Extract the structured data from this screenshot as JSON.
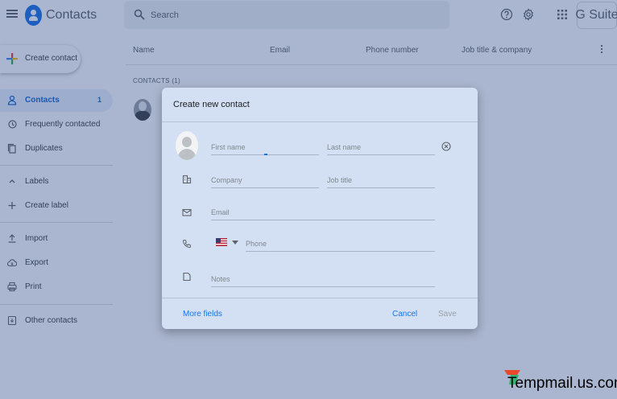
{
  "header": {
    "app_title": "Contacts",
    "search_placeholder": "Search",
    "brand": "G Suite",
    "icons": [
      "menu-icon",
      "contacts-logo-icon",
      "search-icon",
      "help-icon",
      "settings-icon",
      "apps-grid-icon"
    ]
  },
  "sidebar": {
    "create_label": "Create contact",
    "items": [
      {
        "label": "Contacts",
        "count": "1",
        "icon": "person-icon",
        "active": true
      },
      {
        "label": "Frequently contacted",
        "icon": "history-icon"
      },
      {
        "label": "Duplicates",
        "icon": "copy-icon"
      },
      {
        "label": "Labels",
        "icon": "chevron-up-icon"
      },
      {
        "label": "Create label",
        "icon": "plus-icon"
      },
      {
        "label": "Import",
        "icon": "upload-icon"
      },
      {
        "label": "Export",
        "icon": "cloud-download-icon"
      },
      {
        "label": "Print",
        "icon": "printer-icon"
      },
      {
        "label": "Other contacts",
        "icon": "archive-icon"
      }
    ]
  },
  "table": {
    "columns": [
      "Name",
      "Email",
      "Phone number",
      "Job title & company"
    ],
    "section_label": "CONTACTS (1)"
  },
  "dialog": {
    "title": "Create new contact",
    "placeholders": {
      "first_name": "First name",
      "last_name": "Last name",
      "company": "Company",
      "job_title": "Job title",
      "email": "Email",
      "phone": "Phone",
      "notes": "Notes"
    },
    "values": {
      "first_name": "",
      "last_name": "",
      "company": "",
      "job_title": "",
      "email": "",
      "phone": "",
      "notes": ""
    },
    "country_flag": "us-flag-icon",
    "more_fields": "More fields",
    "cancel": "Cancel",
    "save": "Save"
  },
  "colors": {
    "accent": "#1a73e8",
    "dialog_bg": "#d3e0f4",
    "scrim": "#204080"
  },
  "watermark": {
    "text": "Tempmail.us.com"
  }
}
